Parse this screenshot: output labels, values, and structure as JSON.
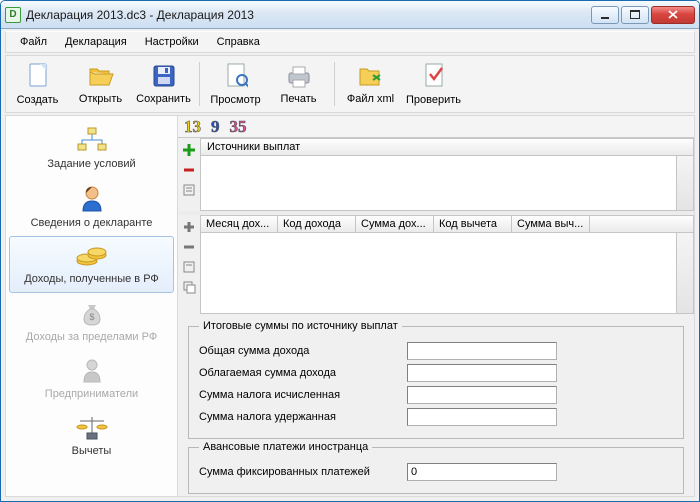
{
  "window": {
    "title": "Декларация 2013.dc3 - Декларация 2013"
  },
  "menu": {
    "file": "Файл",
    "decl": "Декларация",
    "settings": "Настройки",
    "help": "Справка"
  },
  "toolbar": {
    "create": "Создать",
    "open": "Открыть",
    "save": "Сохранить",
    "preview": "Просмотр",
    "print": "Печать",
    "xml": "Файл xml",
    "check": "Проверить"
  },
  "rates": {
    "r13": "13",
    "r9": "9",
    "r35": "35"
  },
  "sidebar": {
    "conditions": "Задание условий",
    "declarant": "Сведения о декларанте",
    "income_rf": "Доходы, полученные в РФ",
    "income_abroad": "Доходы за пределами РФ",
    "entrepreneurs": "Предприниматели",
    "deductions": "Вычеты"
  },
  "sources": {
    "header": "Источники выплат"
  },
  "details": {
    "cols": {
      "month": "Месяц дох...",
      "code": "Код дохода",
      "sum": "Сумма дох...",
      "dedcode": "Код вычета",
      "dedsum": "Сумма выч..."
    }
  },
  "totals": {
    "legend": "Итоговые суммы по источнику выплат",
    "total_income": "Общая сумма дохода",
    "taxable_income": "Облагаемая сумма дохода",
    "tax_calc": "Сумма налога исчисленная",
    "tax_withheld": "Сумма налога удержанная",
    "total_income_val": "",
    "taxable_income_val": "",
    "tax_calc_val": "",
    "tax_withheld_val": ""
  },
  "advance": {
    "legend": "Авансовые платежи иностранца",
    "fixed": "Сумма фиксированных платежей",
    "fixed_val": "0"
  }
}
